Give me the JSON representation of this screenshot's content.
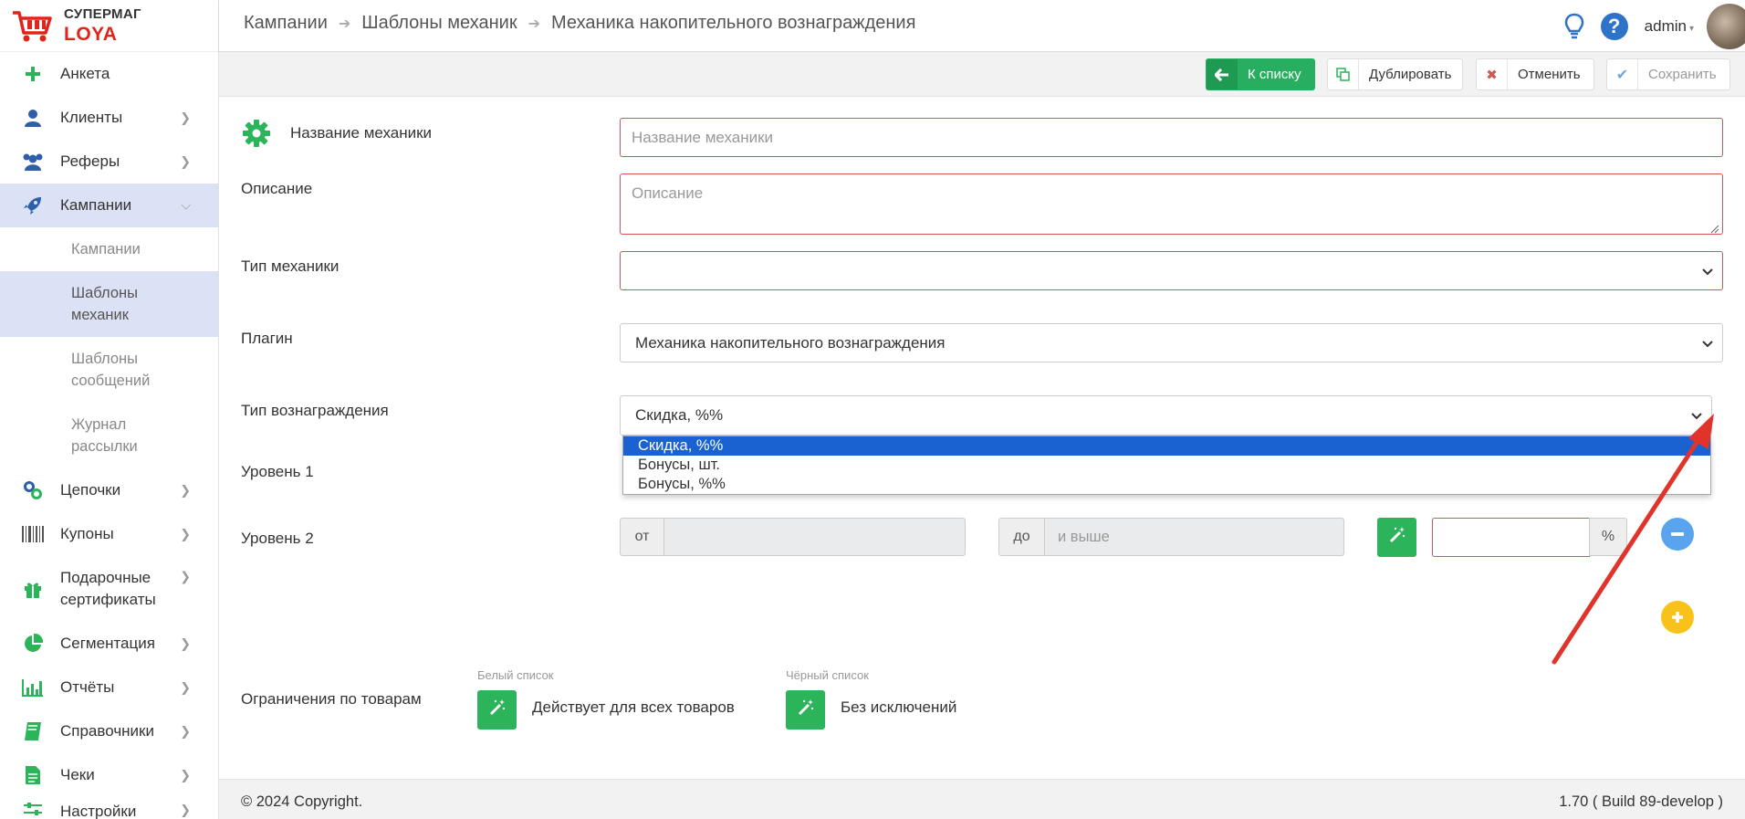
{
  "logo": {
    "top": "СУПЕРМАГ",
    "bottom": "LOYA"
  },
  "sidebar": {
    "items": [
      {
        "label": "Анкета"
      },
      {
        "label": "Клиенты"
      },
      {
        "label": "Реферы"
      },
      {
        "label": "Кампании"
      },
      {
        "label": "Цепочки"
      },
      {
        "label": "Купоны"
      },
      {
        "label": "Подарочные сертификаты"
      },
      {
        "label": "Сегментация"
      },
      {
        "label": "Отчёты"
      },
      {
        "label": "Справочники"
      },
      {
        "label": "Чеки"
      },
      {
        "label": "Настройки"
      }
    ],
    "sub": [
      {
        "label": "Кампании"
      },
      {
        "label": "Шаблоны механик"
      },
      {
        "label": "Шаблоны сообщений"
      },
      {
        "label": "Журнал рассылки"
      }
    ]
  },
  "breadcrumb": [
    "Кампании",
    "Шаблоны механик",
    "Механика накопительного вознаграждения"
  ],
  "header": {
    "user": "admin"
  },
  "toolbar": {
    "back": "К списку",
    "duplicate": "Дублировать",
    "cancel": "Отменить",
    "save": "Сохранить"
  },
  "form": {
    "name_label": "Название механики",
    "name_placeholder": "Название механики",
    "desc_label": "Описание",
    "desc_placeholder": "Описание",
    "type_label": "Тип механики",
    "plugin_label": "Плагин",
    "plugin_value": "Механика накопительного вознаграждения",
    "reward_label": "Тип вознаграждения",
    "reward_value": "Скидка, %%",
    "reward_options": [
      "Скидка, %%",
      "Бонусы, шт.",
      "Бонусы, %%"
    ],
    "level1_label": "Уровень 1",
    "level2_label": "Уровень 2",
    "from": "от",
    "to": "до",
    "to_placeholder": "и выше",
    "percent": "%",
    "restrictions_label": "Ограничения по товарам",
    "whitelist_label": "Белый список",
    "whitelist_value": "Действует для всех товаров",
    "blacklist_label": "Чёрный список",
    "blacklist_value": "Без исключений"
  },
  "footer": {
    "copyright": "© 2024 Copyright.",
    "version": "1.70 ( Build 89-develop )"
  },
  "colors": {
    "accent_green": "#27ae60",
    "error_red": "#d9534f",
    "selected_blue": "#1a62d1",
    "logo_red": "#e2231a"
  }
}
